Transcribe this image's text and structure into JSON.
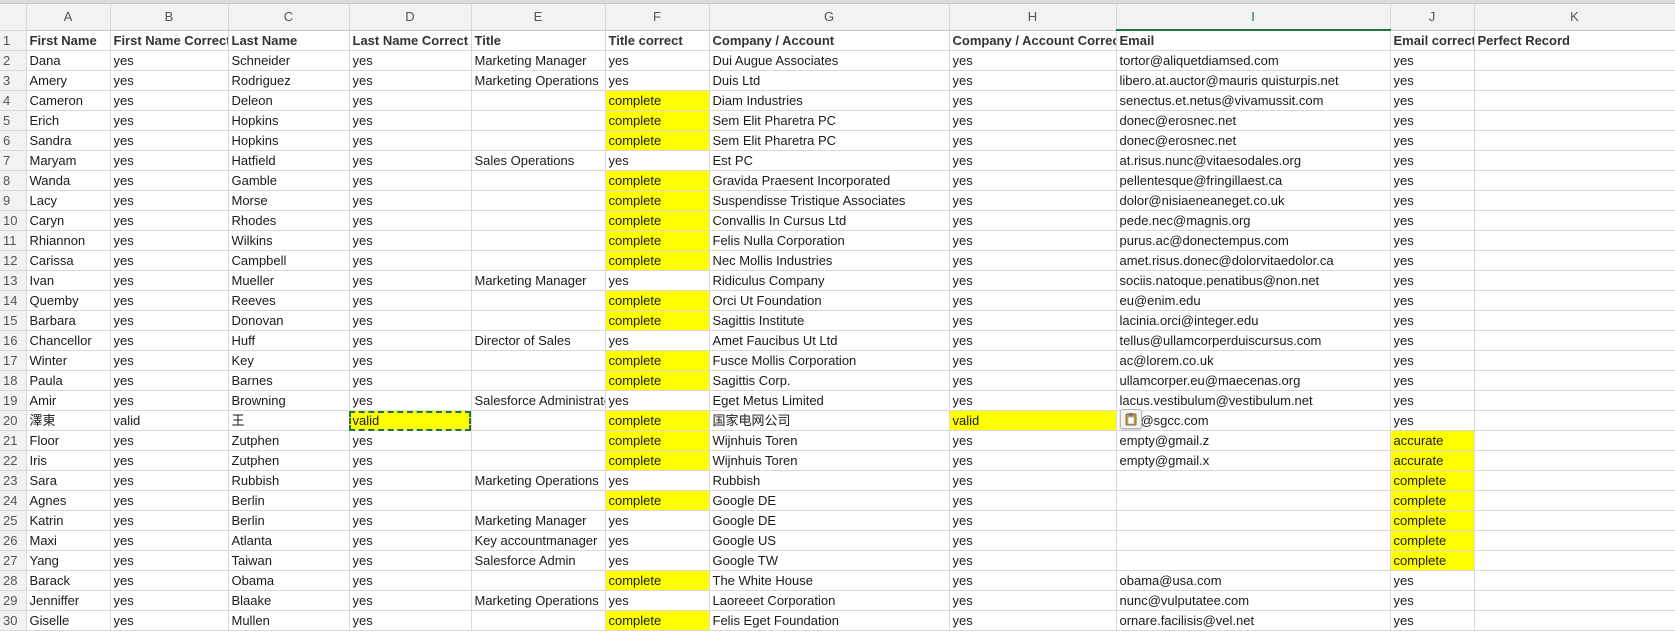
{
  "columns": [
    "A",
    "B",
    "C",
    "D",
    "E",
    "F",
    "G",
    "H",
    "I",
    "J",
    "K"
  ],
  "active_column": "I",
  "rows": [
    {
      "n": "1",
      "cells": [
        "First Name",
        "First Name Correct",
        "Last Name",
        "Last Name Correct",
        "Title",
        "Title correct",
        "Company / Account",
        "Company / Account Correct",
        "Email",
        "Email correct",
        "Perfect Record"
      ],
      "hl": []
    },
    {
      "n": "2",
      "cells": [
        "Dana",
        "yes",
        "Schneider",
        "yes",
        "Marketing Manager",
        "yes",
        "Dui Augue Associates",
        "yes",
        "tortor@aliquetdiamsed.com",
        "yes",
        ""
      ],
      "hl": []
    },
    {
      "n": "3",
      "cells": [
        "Amery",
        "yes",
        "Rodriguez",
        "yes",
        "Marketing Operations",
        "yes",
        "Duis Ltd",
        "yes",
        "libero.at.auctor@mauris quisturpis.net",
        "yes",
        ""
      ],
      "hl": []
    },
    {
      "n": "4",
      "cells": [
        "Cameron",
        "yes",
        "Deleon",
        "yes",
        "",
        "complete",
        "Diam Industries",
        "yes",
        "senectus.et.netus@vivamussit.com",
        "yes",
        ""
      ],
      "hl": [
        5
      ]
    },
    {
      "n": "5",
      "cells": [
        "Erich",
        "yes",
        "Hopkins",
        "yes",
        "",
        "complete",
        "Sem Elit Pharetra PC",
        "yes",
        "donec@erosnec.net",
        "yes",
        ""
      ],
      "hl": [
        5
      ]
    },
    {
      "n": "6",
      "cells": [
        "Sandra",
        "yes",
        "Hopkins",
        "yes",
        "",
        "complete",
        "Sem Elit Pharetra PC",
        "yes",
        "donec@erosnec.net",
        "yes",
        ""
      ],
      "hl": [
        5
      ]
    },
    {
      "n": "7",
      "cells": [
        "Maryam",
        "yes",
        "Hatfield",
        "yes",
        "Sales Operations",
        "yes",
        "Est PC",
        "yes",
        "at.risus.nunc@vitaesodales.org",
        "yes",
        ""
      ],
      "hl": []
    },
    {
      "n": "8",
      "cells": [
        "Wanda",
        "yes",
        "Gamble",
        "yes",
        "",
        "complete",
        "Gravida Praesent Incorporated",
        "yes",
        "pellentesque@fringillaest.ca",
        "yes",
        ""
      ],
      "hl": [
        5
      ]
    },
    {
      "n": "9",
      "cells": [
        "Lacy",
        "yes",
        "Morse",
        "yes",
        "",
        "complete",
        "Suspendisse Tristique Associates",
        "yes",
        "dolor@nisiaeneaneget.co.uk",
        "yes",
        ""
      ],
      "hl": [
        5
      ]
    },
    {
      "n": "10",
      "cells": [
        "Caryn",
        "yes",
        "Rhodes",
        "yes",
        "",
        "complete",
        "Convallis In Cursus Ltd",
        "yes",
        "pede.nec@magnis.org",
        "yes",
        ""
      ],
      "hl": [
        5
      ]
    },
    {
      "n": "11",
      "cells": [
        "Rhiannon",
        "yes",
        "Wilkins",
        "yes",
        "",
        "complete",
        "Felis Nulla Corporation",
        "yes",
        "purus.ac@donectempus.com",
        "yes",
        ""
      ],
      "hl": [
        5
      ]
    },
    {
      "n": "12",
      "cells": [
        "Carissa",
        "yes",
        "Campbell",
        "yes",
        "",
        "complete",
        "Nec Mollis Industries",
        "yes",
        "amet.risus.donec@dolorvitaedolor.ca",
        "yes",
        ""
      ],
      "hl": [
        5
      ]
    },
    {
      "n": "13",
      "cells": [
        "Ivan",
        "yes",
        "Mueller",
        "yes",
        "Marketing Manager",
        "yes",
        "Ridiculus Company",
        "yes",
        "sociis.natoque.penatibus@non.net",
        "yes",
        ""
      ],
      "hl": []
    },
    {
      "n": "14",
      "cells": [
        "Quemby",
        "yes",
        "Reeves",
        "yes",
        "",
        "complete",
        "Orci Ut Foundation",
        "yes",
        "eu@enim.edu",
        "yes",
        ""
      ],
      "hl": [
        5
      ]
    },
    {
      "n": "15",
      "cells": [
        "Barbara",
        "yes",
        "Donovan",
        "yes",
        "",
        "complete",
        "Sagittis Institute",
        "yes",
        "lacinia.orci@integer.edu",
        "yes",
        ""
      ],
      "hl": [
        5
      ]
    },
    {
      "n": "16",
      "cells": [
        "Chancellor",
        "yes",
        "Huff",
        "yes",
        "Director of Sales",
        "yes",
        "Amet Faucibus Ut Ltd",
        "yes",
        "tellus@ullamcorperduiscursus.com",
        "yes",
        ""
      ],
      "hl": []
    },
    {
      "n": "17",
      "cells": [
        "Winter",
        "yes",
        "Key",
        "yes",
        "",
        "complete",
        "Fusce Mollis Corporation",
        "yes",
        "ac@lorem.co.uk",
        "yes",
        ""
      ],
      "hl": [
        5
      ]
    },
    {
      "n": "18",
      "cells": [
        "Paula",
        "yes",
        "Barnes",
        "yes",
        "",
        "complete",
        "Sagittis Corp.",
        "yes",
        "ullamcorper.eu@maecenas.org",
        "yes",
        ""
      ],
      "hl": [
        5
      ]
    },
    {
      "n": "19",
      "cells": [
        "Amir",
        "yes",
        "Browning",
        "yes",
        "Salesforce Administrato",
        "yes",
        "Eget Metus Limited",
        "yes",
        "lacus.vestibulum@vestibulum.net",
        "yes",
        ""
      ],
      "hl": []
    },
    {
      "n": "20",
      "cells": [
        "澤東",
        "valid",
        "王",
        "valid",
        "",
        "complete",
        "国家电网公司",
        "valid",
        "info@sgcc.com",
        "yes",
        ""
      ],
      "hl": [
        3,
        5,
        7
      ]
    },
    {
      "n": "21",
      "cells": [
        "Floor",
        "yes",
        "Zutphen",
        "yes",
        "",
        "complete",
        "Wijnhuis Toren",
        "yes",
        "empty@gmail.z",
        "accurate",
        ""
      ],
      "hl": [
        5,
        9
      ]
    },
    {
      "n": "22",
      "cells": [
        "Iris",
        "yes",
        "Zutphen",
        "yes",
        "",
        "complete",
        "Wijnhuis Toren",
        "yes",
        "empty@gmail.x",
        "accurate",
        ""
      ],
      "hl": [
        5,
        9
      ]
    },
    {
      "n": "23",
      "cells": [
        "Sara",
        "yes",
        "Rubbish",
        "yes",
        "Marketing Operations",
        "yes",
        "Rubbish",
        "yes",
        "",
        "complete",
        ""
      ],
      "hl": [
        9
      ]
    },
    {
      "n": "24",
      "cells": [
        "Agnes",
        "yes",
        "Berlin",
        "yes",
        "",
        "complete",
        "Google DE",
        "yes",
        "",
        "complete",
        ""
      ],
      "hl": [
        5,
        9
      ]
    },
    {
      "n": "25",
      "cells": [
        "Katrin",
        "yes",
        "Berlin",
        "yes",
        "Marketing Manager",
        "yes",
        "Google DE",
        "yes",
        "",
        "complete",
        ""
      ],
      "hl": [
        9
      ]
    },
    {
      "n": "26",
      "cells": [
        "Maxi",
        "yes",
        "Atlanta",
        "yes",
        "Key accountmanager",
        "yes",
        "Google US",
        "yes",
        "",
        "complete",
        ""
      ],
      "hl": [
        9
      ]
    },
    {
      "n": "27",
      "cells": [
        "Yang",
        "yes",
        "Taiwan",
        "yes",
        "Salesforce Admin",
        "yes",
        "Google TW",
        "yes",
        "",
        "complete",
        ""
      ],
      "hl": [
        9
      ]
    },
    {
      "n": "28",
      "cells": [
        "Barack",
        "yes",
        "Obama",
        "yes",
        "",
        "complete",
        "The White House",
        "yes",
        "obama@usa.com",
        "yes",
        ""
      ],
      "hl": [
        5
      ]
    },
    {
      "n": "29",
      "cells": [
        "Jenniffer",
        "yes",
        "Blaake",
        "yes",
        "Marketing Operations",
        "yes",
        "Laoreeet Corporation",
        "yes",
        "nunc@vulputatee.com",
        "yes",
        ""
      ],
      "hl": []
    },
    {
      "n": "30",
      "cells": [
        "Giselle",
        "yes",
        "Mullen",
        "yes",
        "",
        "complete",
        "Felis Eget Foundation",
        "yes",
        "ornare.facilisis@vel.net",
        "yes",
        ""
      ],
      "hl": [
        5
      ]
    }
  ],
  "selected_cell": {
    "row": "20",
    "col": "D"
  },
  "highlight_color": "#ffff00",
  "selection_color": "#217346",
  "paste_icon": "clipboard-icon"
}
